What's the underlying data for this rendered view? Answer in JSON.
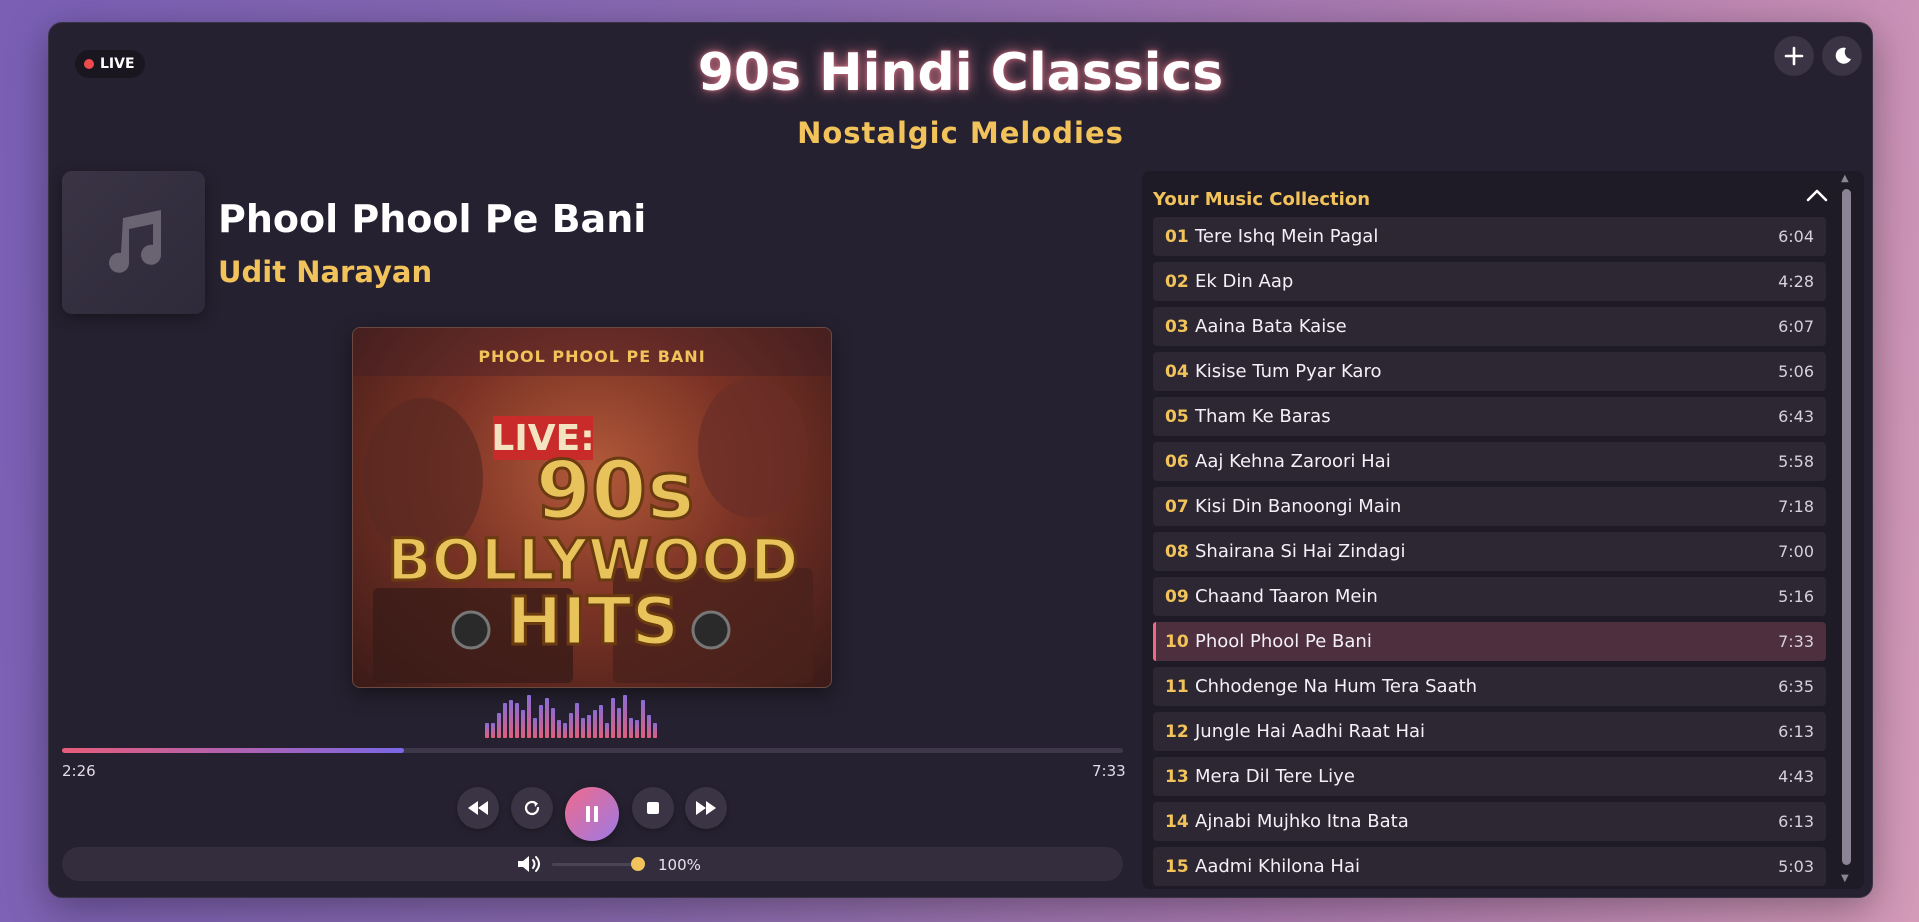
{
  "header": {
    "live_label": "LIVE",
    "title": "90s Hindi Classics",
    "subtitle": "Nostalgic Melodies",
    "add_icon": "plus-icon",
    "theme_icon": "moon-icon"
  },
  "now_playing": {
    "title": "Phool Phool Pe Bani",
    "artist": "Udit Narayan",
    "thumb_icon": "music-note-icon",
    "cover_label": "PHOOL PHOOL PE BANI",
    "cover_art_text": [
      "LIVE:",
      "90s",
      "BOLLYWOOD",
      "HITS"
    ]
  },
  "progress": {
    "current_time": "2:26",
    "total_time": "7:33",
    "fraction": 0.322
  },
  "controls": {
    "rewind_icon": "rewind-icon",
    "repeat_icon": "repeat-icon",
    "pause_icon": "pause-icon",
    "stop_icon": "stop-icon",
    "forward_icon": "fast-forward-icon"
  },
  "volume": {
    "icon": "speaker-icon",
    "level": 1.0,
    "label": "100%"
  },
  "playlist": {
    "header": "Your Music Collection",
    "active_index": 9,
    "tracks": [
      {
        "num": "01",
        "title": "Tere Ishq Mein Pagal",
        "duration": "6:04"
      },
      {
        "num": "02",
        "title": "Ek Din Aap",
        "duration": "4:28"
      },
      {
        "num": "03",
        "title": "Aaina Bata Kaise",
        "duration": "6:07"
      },
      {
        "num": "04",
        "title": "Kisise Tum Pyar Karo",
        "duration": "5:06"
      },
      {
        "num": "05",
        "title": "Tham Ke Baras",
        "duration": "6:43"
      },
      {
        "num": "06",
        "title": "Aaj Kehna Zaroori Hai",
        "duration": "5:58"
      },
      {
        "num": "07",
        "title": "Kisi Din Banoongi Main",
        "duration": "7:18"
      },
      {
        "num": "08",
        "title": "Shairana Si Hai Zindagi",
        "duration": "7:00"
      },
      {
        "num": "09",
        "title": "Chaand Taaron Mein",
        "duration": "5:16"
      },
      {
        "num": "10",
        "title": "Phool Phool Pe Bani",
        "duration": "7:33"
      },
      {
        "num": "11",
        "title": "Chhodenge Na Hum Tera Saath",
        "duration": "6:35"
      },
      {
        "num": "12",
        "title": "Jungle Hai Aadhi Raat Hai",
        "duration": "6:13"
      },
      {
        "num": "13",
        "title": "Mera Dil Tere Liye",
        "duration": "4:43"
      },
      {
        "num": "14",
        "title": "Ajnabi Mujhko Itna Bata",
        "duration": "6:13"
      },
      {
        "num": "15",
        "title": "Aadmi Khilona Hai",
        "duration": "5:03"
      }
    ]
  },
  "visualizer_levels": [
    0.3,
    0.3,
    0.5,
    0.7,
    0.75,
    0.7,
    0.55,
    0.85,
    0.4,
    0.65,
    0.8,
    0.6,
    0.35,
    0.3,
    0.5,
    0.7,
    0.4,
    0.45,
    0.55,
    0.65,
    0.3,
    0.8,
    0.6,
    0.85,
    0.4,
    0.35,
    0.75,
    0.45,
    0.3
  ]
}
